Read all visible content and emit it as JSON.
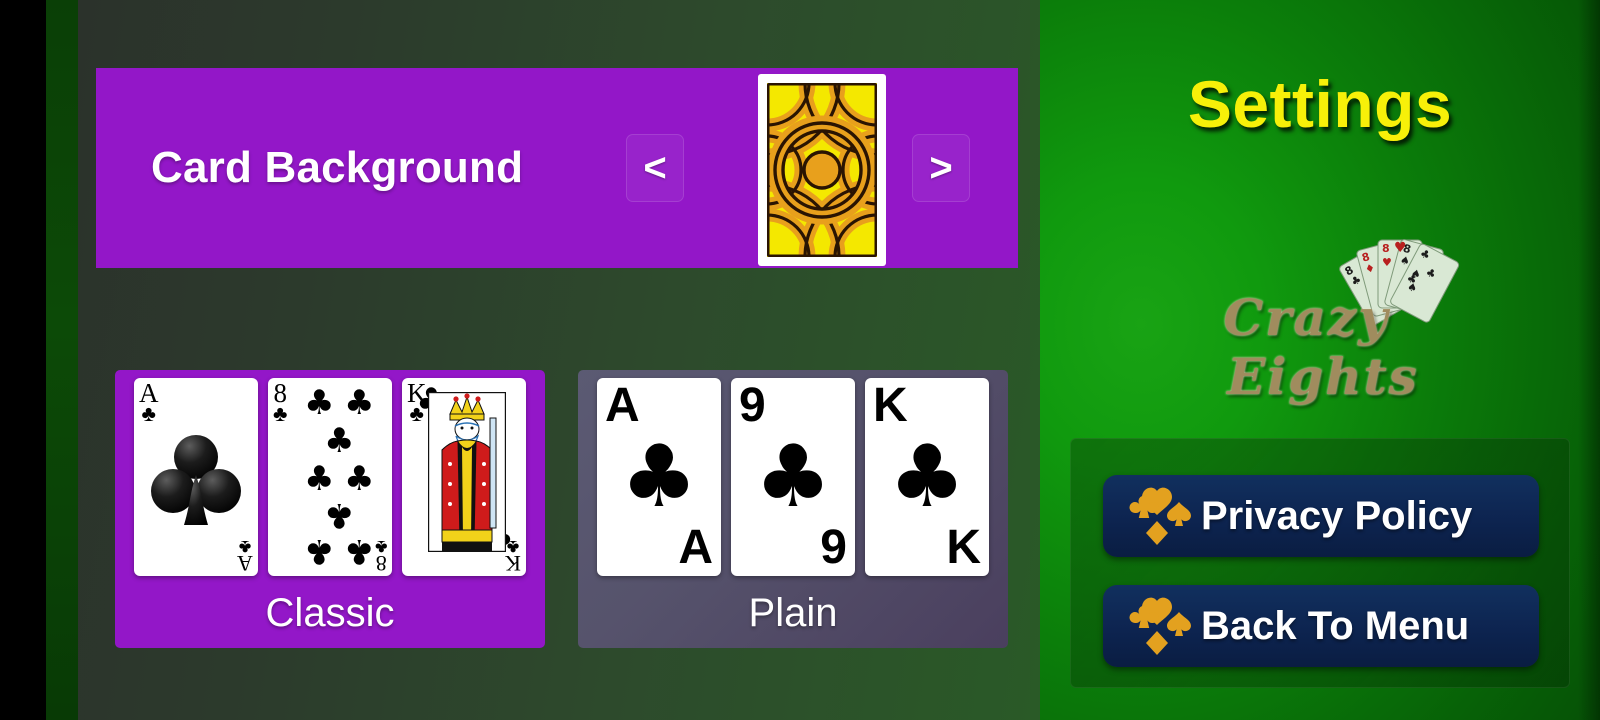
{
  "app": {
    "logo_text_part1": "Crazy",
    "logo_text_part2": "Eights"
  },
  "right_panel": {
    "title": "Settings",
    "buttons": [
      {
        "label": "Privacy Policy",
        "icon": "four-suits-icon"
      },
      {
        "label": "Back To Menu",
        "icon": "four-suits-icon"
      }
    ]
  },
  "card_background": {
    "label": "Card Background",
    "prev_label": "<",
    "next_label": ">",
    "selected_pattern": "yellow-orange-concentric-rings",
    "colors": {
      "panel": "#9317c8",
      "pattern_light": "#f4e800",
      "pattern_dark": "#e8a01c"
    }
  },
  "card_style": {
    "options": [
      {
        "name": "Classic",
        "selected": true,
        "background": "#9317c8",
        "cards": [
          {
            "rank": "A",
            "suit": "♣",
            "art": "shaded-club"
          },
          {
            "rank": "8",
            "suit": "♣",
            "art": "eight-pips"
          },
          {
            "rank": "K",
            "suit": "♣",
            "art": "king-portrait"
          }
        ]
      },
      {
        "name": "Plain",
        "selected": false,
        "background": "#56536c",
        "cards": [
          {
            "rank": "A",
            "suit": "♣",
            "art": "single-pip"
          },
          {
            "rank": "9",
            "suit": "♣",
            "art": "single-pip"
          },
          {
            "rank": "K",
            "suit": "♣",
            "art": "single-pip"
          }
        ]
      }
    ]
  },
  "theme": {
    "accent_purple": "#9317c8",
    "title_yellow": "#f7f009",
    "button_navy": "#0d2450",
    "suit_orange": "#e3a11f",
    "panel_green_dark": "#2b322b"
  }
}
